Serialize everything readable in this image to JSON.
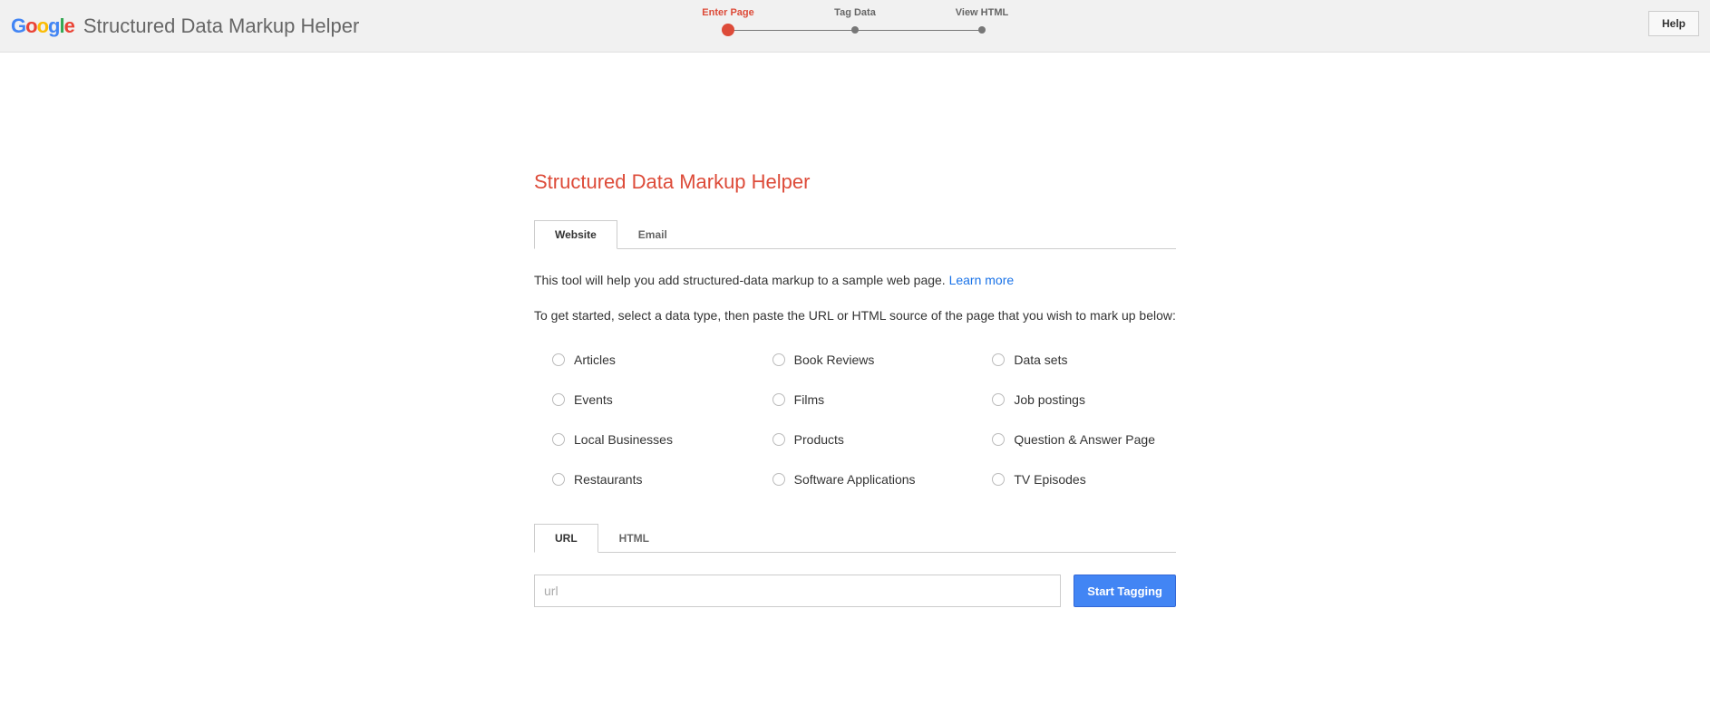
{
  "header": {
    "app_title": "Structured Data Markup Helper",
    "help": "Help"
  },
  "stepper": {
    "step1": "Enter Page",
    "step2": "Tag Data",
    "step3": "View HTML"
  },
  "main": {
    "title": "Structured Data Markup Helper",
    "tabs": {
      "website": "Website",
      "email": "Email"
    },
    "intro1a": "This tool will help you add structured-data markup to a sample web page. ",
    "intro1_link": "Learn more",
    "intro2": "To get started, select a data type, then paste the URL or HTML source of the page that you wish to mark up below:",
    "data_types": {
      "col1": [
        "Articles",
        "Events",
        "Local Businesses",
        "Restaurants"
      ],
      "col2": [
        "Book Reviews",
        "Films",
        "Products",
        "Software Applications"
      ],
      "col3": [
        "Data sets",
        "Job postings",
        "Question & Answer Page",
        "TV Episodes"
      ]
    },
    "url_tabs": {
      "url": "URL",
      "html": "HTML"
    },
    "url_placeholder": "url",
    "start_button": "Start Tagging"
  }
}
